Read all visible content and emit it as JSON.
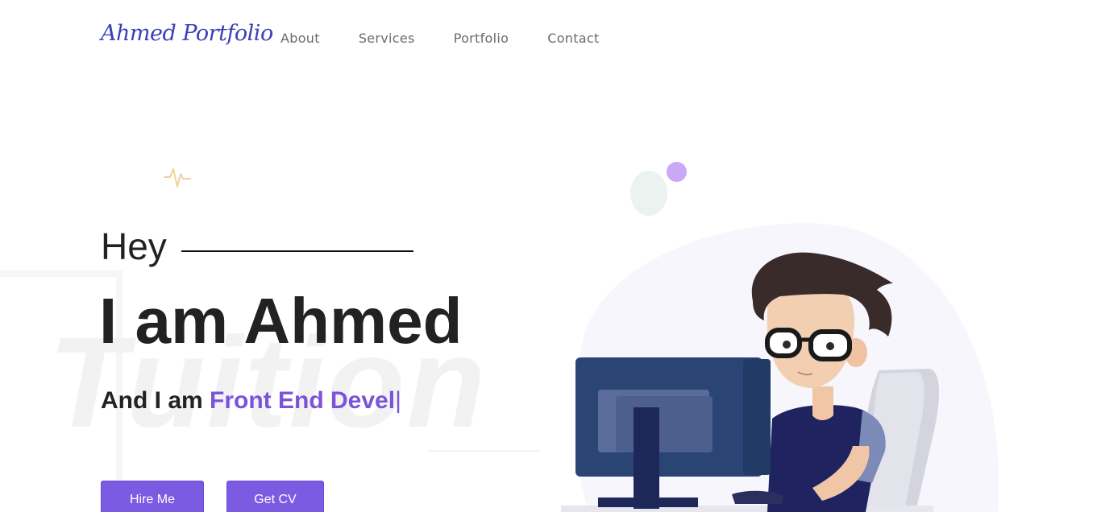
{
  "nav": {
    "logo": "Ahmed Portfolio",
    "links": [
      "About",
      "Services",
      "Portfolio",
      "Contact"
    ]
  },
  "hero": {
    "greeting": "Hey",
    "name_line": "I am Ahmed",
    "role_lead": "And I am",
    "role_typed": "Front End Devel",
    "caret": "|",
    "watermark": "Tuition"
  },
  "buttons": {
    "hire": "Hire Me",
    "cv": "Get CV"
  },
  "colors": {
    "accent": "#7b5be2",
    "logo": "#3b3fb8",
    "typed_text": "#7b53d8"
  },
  "icons": {
    "pulse": "pulse-icon",
    "illustration": "developer-at-computer-illustration"
  }
}
